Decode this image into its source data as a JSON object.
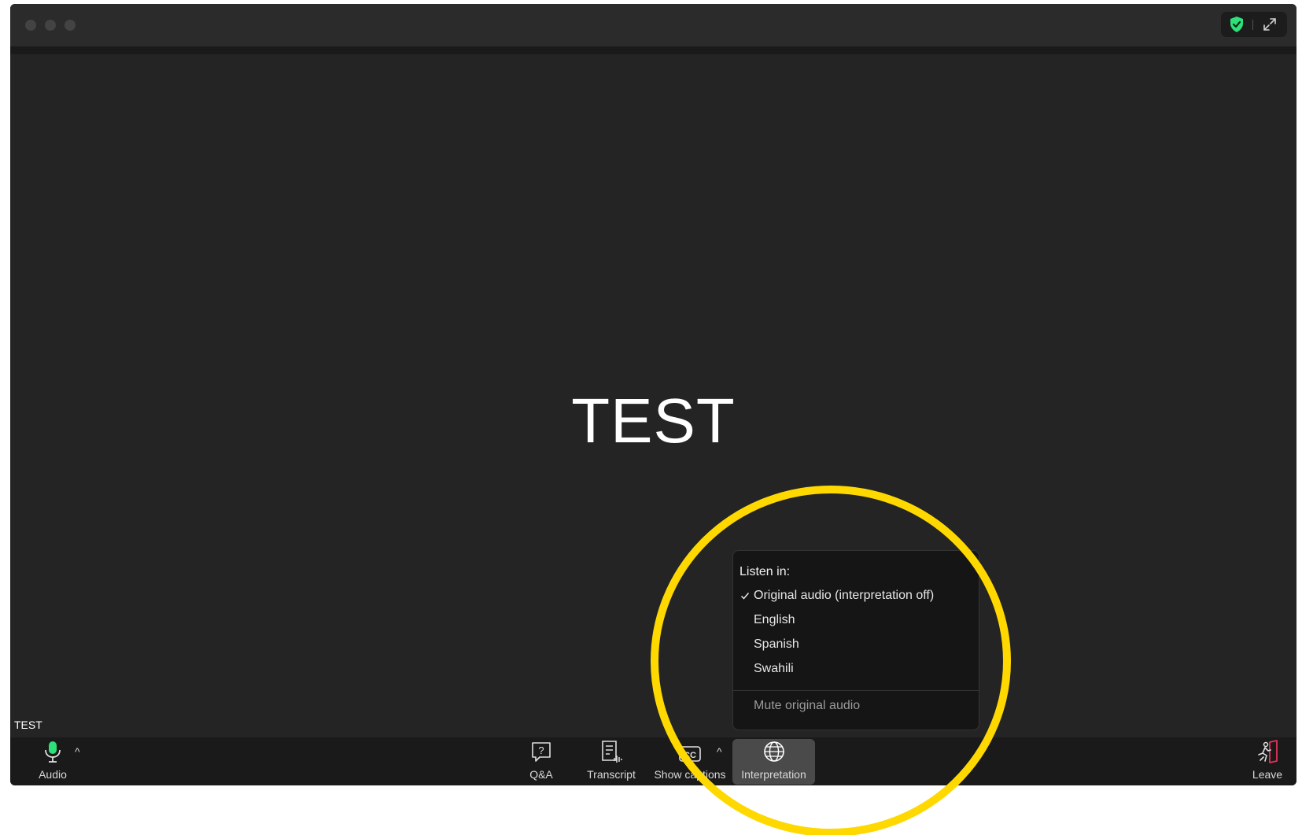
{
  "window": {
    "shield_icon": "shield-check-icon",
    "expand_icon": "expand-icon"
  },
  "stage": {
    "presenter_text": "TEST",
    "name_tag": "TEST"
  },
  "toolbar": {
    "audio_label": "Audio",
    "qa_label": "Q&A",
    "transcript_label": "Transcript",
    "captions_label": "Show captions",
    "interpretation_label": "Interpretation",
    "leave_label": "Leave"
  },
  "interpretation_menu": {
    "header": "Listen in:",
    "options": [
      {
        "label": "Original audio (interpretation off)",
        "selected": true
      },
      {
        "label": "English",
        "selected": false
      },
      {
        "label": "Spanish",
        "selected": false
      },
      {
        "label": "Swahili",
        "selected": false
      }
    ],
    "mute_label": "Mute original audio"
  },
  "colors": {
    "accent_green": "#2ee07a",
    "leave_red": "#e8305a",
    "annotation_yellow": "#ffd800"
  }
}
